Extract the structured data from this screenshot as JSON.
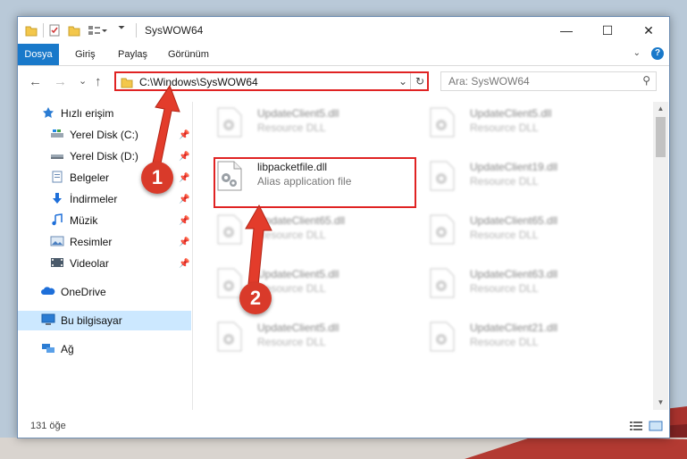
{
  "window": {
    "title": "SysWOW64",
    "minimize": "—",
    "maximize": "☐",
    "close": "✕"
  },
  "ribbon": {
    "tabs": [
      "Dosya",
      "Giriş",
      "Paylaş",
      "Görünüm"
    ],
    "help": "?"
  },
  "nav": {
    "back": "←",
    "forward": "→",
    "recent": "⌄",
    "up": "↑",
    "address": "C:\\Windows\\SysWOW64",
    "search_placeholder": "Ara: SysWOW64"
  },
  "sidebar": {
    "items": [
      {
        "label": "Hızlı erişim"
      },
      {
        "label": "Yerel Disk (C:)"
      },
      {
        "label": "Yerel Disk (D:)"
      },
      {
        "label": "Belgeler"
      },
      {
        "label": "İndirmeler"
      },
      {
        "label": "Müzik"
      },
      {
        "label": "Resimler"
      },
      {
        "label": "Videolar"
      },
      {
        "label": "OneDrive"
      },
      {
        "label": "Bu bilgisayar"
      },
      {
        "label": "Ağ"
      }
    ]
  },
  "files": [
    {
      "name": "UpdateClient5.dll",
      "type": "Resource DLL"
    },
    {
      "name": "UpdateClient5.dll",
      "type": "Resource DLL"
    },
    {
      "name": "libpacketfile.dll",
      "type": "Alias application file"
    },
    {
      "name": "UpdateClient19.dll",
      "type": "Resource DLL"
    },
    {
      "name": "UpdateClient65.dll",
      "type": "Resource DLL"
    },
    {
      "name": "UpdateClient65.dll",
      "type": "Resource DLL"
    },
    {
      "name": "UpdateClient5.dll",
      "type": "Resource DLL"
    },
    {
      "name": "UpdateClient63.dll",
      "type": "Resource DLL"
    },
    {
      "name": "UpdateClient5.dll",
      "type": "Resource DLL"
    },
    {
      "name": "UpdateClient21.dll",
      "type": "Resource DLL"
    }
  ],
  "status": {
    "count": "131 öğe"
  },
  "callouts": [
    "1",
    "2"
  ],
  "colors": {
    "accent": "#1979ca",
    "highlight": "#e02323",
    "callout": "#d93a2a",
    "selected": "#cce8ff"
  }
}
